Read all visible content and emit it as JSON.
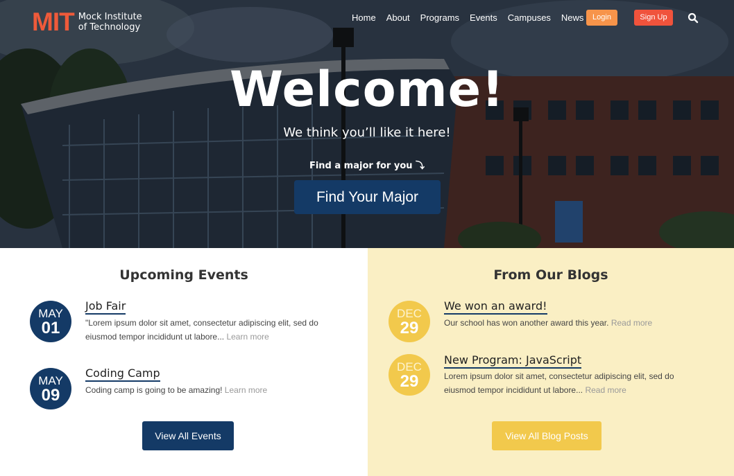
{
  "brand": {
    "logo_mark": "MIT",
    "name_line1": "Mock Institute",
    "name_line2": "of Technology"
  },
  "nav": {
    "items": [
      "Home",
      "About",
      "Programs",
      "Events",
      "Campuses",
      "News"
    ],
    "login": "Login",
    "signup": "Sign Up",
    "search_icon": "search-icon"
  },
  "hero": {
    "title": "Welcome!",
    "tagline": "We think you’ll like it here!",
    "find_label": "Find a major for you ⤵",
    "cta": "Find Your Major"
  },
  "events": {
    "title": "Upcoming Events",
    "items": [
      {
        "month": "MAY",
        "day": "01",
        "title": "Job Fair",
        "desc": "\"Lorem ipsum dolor sit amet, consectetur adipiscing elit, sed do eiusmod tempor incididunt ut labore...",
        "more": "Learn more"
      },
      {
        "month": "MAY",
        "day": "09",
        "title": "Coding Camp",
        "desc": "Coding camp is going to be amazing!",
        "more": "Learn more"
      }
    ],
    "button": "View All Events"
  },
  "blogs": {
    "title": "From Our Blogs",
    "items": [
      {
        "month": "DEC",
        "day": "29",
        "title": "We won an award!",
        "desc": "Our school has won another award this year.",
        "more": "Read more"
      },
      {
        "month": "DEC",
        "day": "29",
        "title": "New Program: JavaScript",
        "desc": "Lorem ipsum dolor sit amet, consectetur adipiscing elit, sed do eiusmod tempor incididunt ut labore...",
        "more": "Read more"
      }
    ],
    "button": "View All Blog Posts"
  },
  "colors": {
    "brand_orange": "#ef5a3a",
    "login": "#f7944a",
    "signup": "#f0533c",
    "navy": "#143a66",
    "gold": "#f2c94c",
    "blog_bg": "#faefc4"
  }
}
